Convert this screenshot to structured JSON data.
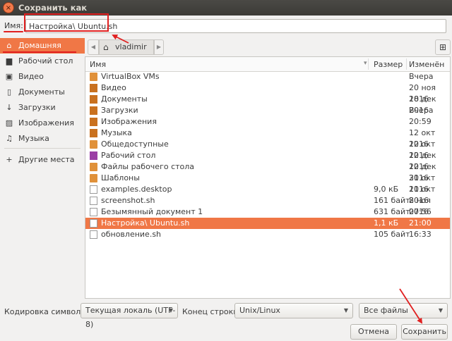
{
  "window": {
    "title": "Сохранить как",
    "close_symbol": "×"
  },
  "name_row": {
    "label": "Имя:",
    "value": "Настройка\\ Ubuntu.sh"
  },
  "sidebar": {
    "items": [
      {
        "label": "Домашняя папка",
        "icon": "home-icon",
        "glyph": "⌂",
        "active": true
      },
      {
        "label": "Рабочий стол",
        "icon": "desktop-icon",
        "glyph": "▆",
        "active": false
      },
      {
        "label": "Видео",
        "icon": "video-icon",
        "glyph": "▣",
        "active": false
      },
      {
        "label": "Документы",
        "icon": "document-icon",
        "glyph": "▯",
        "active": false
      },
      {
        "label": "Загрузки",
        "icon": "download-icon",
        "glyph": "↓",
        "active": false
      },
      {
        "label": "Изображения",
        "icon": "image-icon",
        "glyph": "▨",
        "active": false
      },
      {
        "label": "Музыка",
        "icon": "music-icon",
        "glyph": "♫",
        "active": false
      },
      {
        "label": "Другие места",
        "icon": "plus-icon",
        "glyph": "+",
        "active": false
      }
    ]
  },
  "path_bar": {
    "crumb": "vladimir",
    "home_glyph": "⌂",
    "left_arrow": "◀",
    "right_arrow": "▶",
    "new_folder_glyph": "⊞"
  },
  "columns": {
    "name": "Имя",
    "size": "Размер",
    "modified": "Изменён"
  },
  "files": [
    {
      "name": "VirtualBox VMs",
      "size": "",
      "modified": "Вчера",
      "kind": "folder"
    },
    {
      "name": "Видео",
      "size": "",
      "modified": "20 ноя 2016",
      "kind": "special"
    },
    {
      "name": "Документы",
      "size": "",
      "modified": "18 дек 2016",
      "kind": "special"
    },
    {
      "name": "Загрузки",
      "size": "",
      "modified": "Вчера",
      "kind": "special"
    },
    {
      "name": "Изображения",
      "size": "",
      "modified": "20:59",
      "kind": "special"
    },
    {
      "name": "Музыка",
      "size": "",
      "modified": "12 окт 2016",
      "kind": "special"
    },
    {
      "name": "Общедоступные",
      "size": "",
      "modified": "12 окт 2016",
      "kind": "folder"
    },
    {
      "name": "Рабочий стол",
      "size": "",
      "modified": "12 дек 2016",
      "kind": "purple"
    },
    {
      "name": "Файлы рабочего стола",
      "size": "",
      "modified": "12 дек 2016",
      "kind": "folder"
    },
    {
      "name": "Шаблоны",
      "size": "",
      "modified": "31 окт 2016",
      "kind": "folder"
    },
    {
      "name": "examples.desktop",
      "size": "9,0 кБ",
      "modified": "11 окт 2016",
      "kind": "doc"
    },
    {
      "name": "screenshot.sh",
      "size": "161 байт",
      "modified": "8 ноя 2016",
      "kind": "doc"
    },
    {
      "name": "Безымянный документ 1",
      "size": "631 байт",
      "modified": "07:56",
      "kind": "doc"
    },
    {
      "name": "Настройка\\ Ubuntu.sh",
      "size": "1,1 кБ",
      "modified": "21:00",
      "kind": "doc",
      "selected": true
    },
    {
      "name": "обновление.sh",
      "size": "105 байт",
      "modified": "16:33",
      "kind": "doc"
    }
  ],
  "bottom": {
    "encoding_label": "Кодировка символов:",
    "encoding_value": "Текущая локаль (UTF-8)",
    "line_end_label": "Конец строки:",
    "line_end_value": "Unix/Linux",
    "filter_value": "Все файлы",
    "cancel_label": "Отмена",
    "save_label": "Сохранить"
  },
  "colors": {
    "accent": "#f07746",
    "annotation": "#e02020"
  }
}
